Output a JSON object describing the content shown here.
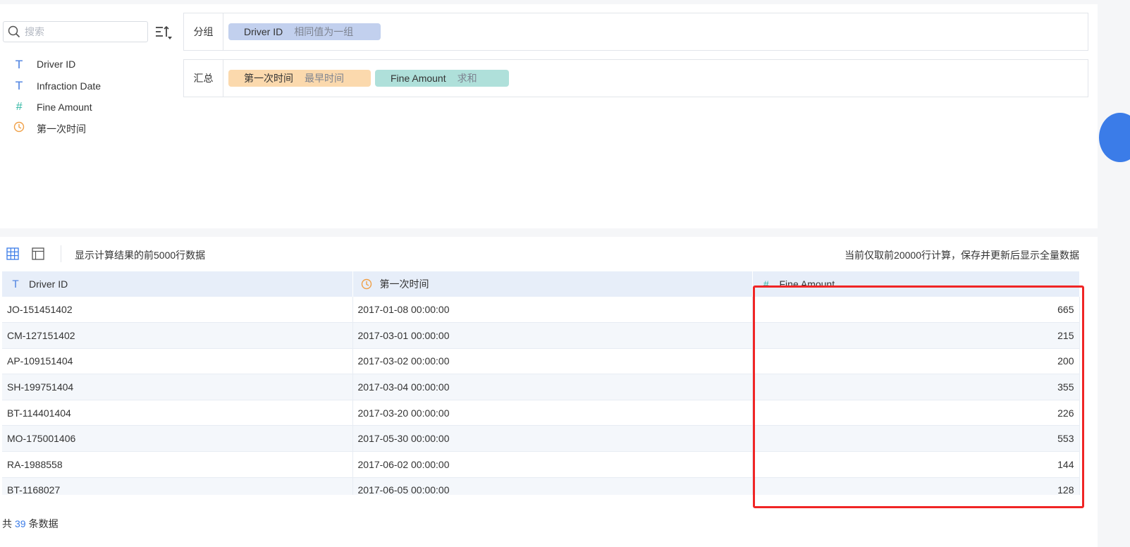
{
  "sidebar": {
    "search_placeholder": "搜索",
    "fields": [
      {
        "label": "Driver ID",
        "icon": "text-type-icon",
        "glyph": "T"
      },
      {
        "label": "Infraction Date",
        "icon": "text-type-icon",
        "glyph": "T"
      },
      {
        "label": "Fine Amount",
        "icon": "number-type-icon",
        "glyph": "#"
      },
      {
        "label": "第一次时间",
        "icon": "date-type-icon",
        "glyph": "clock"
      }
    ]
  },
  "group_zone": {
    "label": "分组",
    "chips": [
      {
        "field": "Driver ID",
        "mode": "相同值为一组",
        "color": "#c2d0ee"
      }
    ]
  },
  "summary_zone": {
    "label": "汇总",
    "chips": [
      {
        "field": "第一次时间",
        "mode": "最早时间",
        "color": "#fbd9ad"
      },
      {
        "field": "Fine Amount",
        "mode": "求和",
        "color": "#afe0da"
      }
    ]
  },
  "results": {
    "note_left": "显示计算结果的前5000行数据",
    "note_right": "当前仅取前20000行计算，保存并更新后显示全量数据",
    "columns": [
      "Driver ID",
      "第一次时间",
      "Fine Amount"
    ],
    "rows": [
      [
        "JO-151451402",
        "2017-01-08 00:00:00",
        "665"
      ],
      [
        "CM-127151402",
        "2017-03-01 00:00:00",
        "215"
      ],
      [
        "AP-109151404",
        "2017-03-02 00:00:00",
        "200"
      ],
      [
        "SH-199751404",
        "2017-03-04 00:00:00",
        "355"
      ],
      [
        "BT-114401404",
        "2017-03-20 00:00:00",
        "226"
      ],
      [
        "MO-175001406",
        "2017-05-30 00:00:00",
        "553"
      ],
      [
        "RA-1988558",
        "2017-06-02 00:00:00",
        "144"
      ],
      [
        "BT-1168027",
        "2017-06-05 00:00:00",
        "128"
      ]
    ],
    "footer_prefix": "共",
    "footer_count": "39",
    "footer_suffix": "条数据"
  },
  "colors": {
    "accent": "#3b7ce8",
    "highlight": "#f02525",
    "header_bg": "#e7eef9"
  }
}
